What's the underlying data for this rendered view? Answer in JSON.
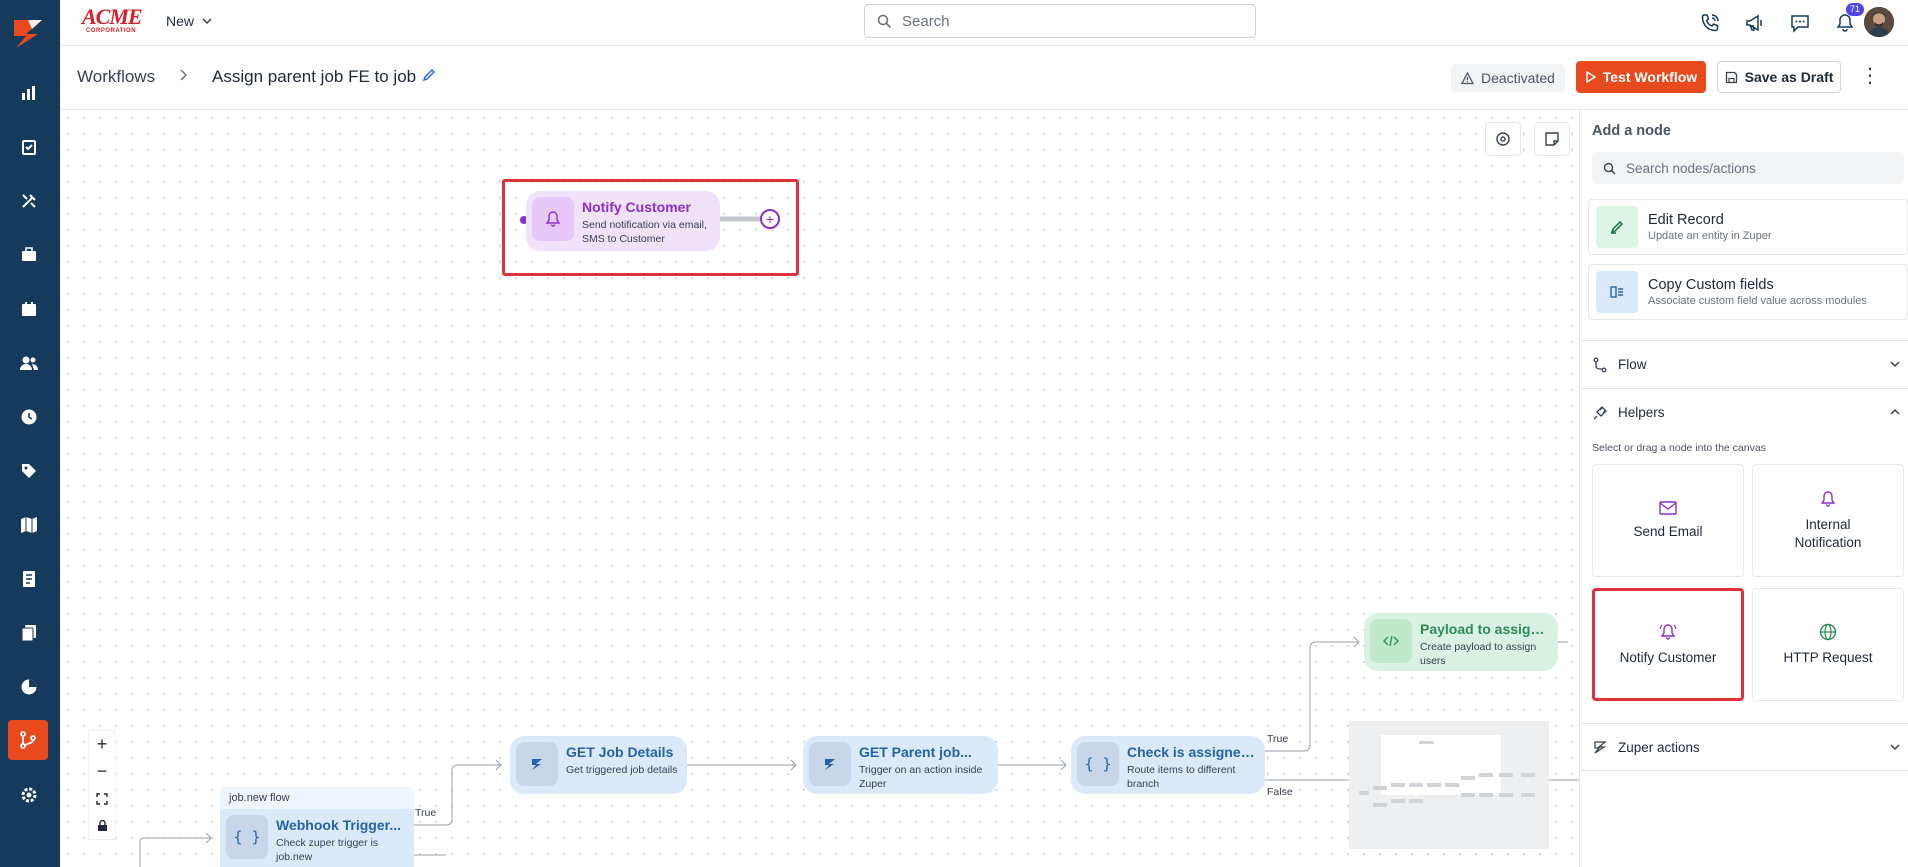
{
  "topbar": {
    "brand_name": "ACME",
    "brand_sub": "CORPORATION",
    "new_label": "New",
    "search_placeholder": "Search",
    "notification_count": "71"
  },
  "header": {
    "breadcrumb_root": "Workflows",
    "workflow_name": "Assign parent job FE to job",
    "status": "Deactivated",
    "test_button": "Test Workflow",
    "draft_button": "Save as Draft"
  },
  "canvas": {
    "nodes": {
      "notify": {
        "title": "Notify Customer",
        "desc": "Send notification via email, SMS to Customer"
      },
      "get_job": {
        "title": "GET Job Details",
        "desc": "Get triggered job details"
      },
      "get_parent": {
        "title": "GET Parent job...",
        "desc": "Trigger on an action inside Zuper"
      },
      "check_assigned": {
        "title": "Check is assigned...",
        "desc": "Route items to different branch"
      },
      "payload": {
        "title": "Payload to assign...",
        "desc": "Create payload to assign users"
      },
      "webhook": {
        "title": "Webhook Trigger...",
        "desc": "Check zuper trigger is job.new"
      }
    },
    "flow_tag": "job.new flow",
    "labels": {
      "true1": "True",
      "true2": "True",
      "false1": "False"
    },
    "zoom": {
      "in": "+",
      "out": "−"
    }
  },
  "panel": {
    "title": "Add a node",
    "search_placeholder": "Search nodes/actions",
    "actions": [
      {
        "title": "Edit Record",
        "desc": "Update an entity in Zuper"
      },
      {
        "title": "Copy Custom fields",
        "desc": "Associate custom field value across modules"
      }
    ],
    "sections": {
      "flow": "Flow",
      "helpers": "Helpers",
      "zuper_actions": "Zuper actions"
    },
    "hint": "Select or drag a node into the canvas",
    "tiles": [
      "Send Email",
      "Internal Notification",
      "Notify Customer",
      "HTTP Request"
    ]
  },
  "colors": {
    "accent": "#e8491d",
    "nav": "#163a5c",
    "highlight": "#e0313a"
  }
}
